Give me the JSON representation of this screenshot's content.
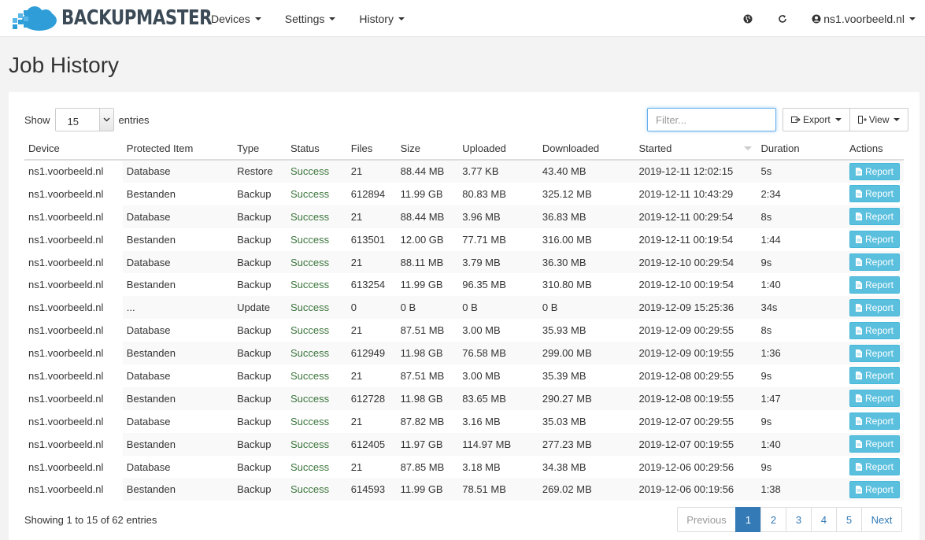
{
  "navbar": {
    "brand": "BACKUPMASTER",
    "menu": [
      {
        "label": "Devices"
      },
      {
        "label": "Settings"
      },
      {
        "label": "History"
      }
    ],
    "user": "ns1.voorbeeld.nl",
    "icons": [
      "globe-icon",
      "refresh-icon",
      "user-icon"
    ]
  },
  "page_title": "Job History",
  "controls": {
    "show_label": "Show",
    "entries_value": "15",
    "entries_label": "entries",
    "filter_placeholder": "Filter...",
    "export_label": "Export",
    "view_label": "View"
  },
  "table": {
    "columns": [
      "Device",
      "Protected Item",
      "Type",
      "Status",
      "Files",
      "Size",
      "Uploaded",
      "Downloaded",
      "Started",
      "Duration",
      "Actions"
    ],
    "action_label": "Report",
    "rows": [
      [
        "ns1.voorbeeld.nl",
        "Database",
        "Restore",
        "Success",
        "21",
        "88.44 MB",
        "3.77 KB",
        "43.40 MB",
        "2019-12-11 12:02:15",
        "5s"
      ],
      [
        "ns1.voorbeeld.nl",
        "Bestanden",
        "Backup",
        "Success",
        "612894",
        "11.99 GB",
        "80.83 MB",
        "325.12 MB",
        "2019-12-11 10:43:29",
        "2:34"
      ],
      [
        "ns1.voorbeeld.nl",
        "Database",
        "Backup",
        "Success",
        "21",
        "88.44 MB",
        "3.96 MB",
        "36.83 MB",
        "2019-12-11 00:29:54",
        "8s"
      ],
      [
        "ns1.voorbeeld.nl",
        "Bestanden",
        "Backup",
        "Success",
        "613501",
        "12.00 GB",
        "77.71 MB",
        "316.00 MB",
        "2019-12-11 00:19:54",
        "1:44"
      ],
      [
        "ns1.voorbeeld.nl",
        "Database",
        "Backup",
        "Success",
        "21",
        "88.11 MB",
        "3.79 MB",
        "36.30 MB",
        "2019-12-10 00:29:54",
        "9s"
      ],
      [
        "ns1.voorbeeld.nl",
        "Bestanden",
        "Backup",
        "Success",
        "613254",
        "11.99 GB",
        "96.35 MB",
        "310.80 MB",
        "2019-12-10 00:19:54",
        "1:40"
      ],
      [
        "ns1.voorbeeld.nl",
        "...",
        "Update",
        "Success",
        "0",
        "0 B",
        "0 B",
        "0 B",
        "2019-12-09 15:25:36",
        "34s"
      ],
      [
        "ns1.voorbeeld.nl",
        "Database",
        "Backup",
        "Success",
        "21",
        "87.51 MB",
        "3.00 MB",
        "35.93 MB",
        "2019-12-09 00:29:55",
        "8s"
      ],
      [
        "ns1.voorbeeld.nl",
        "Bestanden",
        "Backup",
        "Success",
        "612949",
        "11.98 GB",
        "76.58 MB",
        "299.00 MB",
        "2019-12-09 00:19:55",
        "1:36"
      ],
      [
        "ns1.voorbeeld.nl",
        "Database",
        "Backup",
        "Success",
        "21",
        "87.51 MB",
        "3.00 MB",
        "35.39 MB",
        "2019-12-08 00:29:55",
        "9s"
      ],
      [
        "ns1.voorbeeld.nl",
        "Bestanden",
        "Backup",
        "Success",
        "612728",
        "11.98 GB",
        "83.65 MB",
        "290.27 MB",
        "2019-12-08 00:19:55",
        "1:47"
      ],
      [
        "ns1.voorbeeld.nl",
        "Database",
        "Backup",
        "Success",
        "21",
        "87.82 MB",
        "3.16 MB",
        "35.03 MB",
        "2019-12-07 00:29:55",
        "9s"
      ],
      [
        "ns1.voorbeeld.nl",
        "Bestanden",
        "Backup",
        "Success",
        "612405",
        "11.97 GB",
        "114.97 MB",
        "277.23 MB",
        "2019-12-07 00:19:55",
        "1:40"
      ],
      [
        "ns1.voorbeeld.nl",
        "Database",
        "Backup",
        "Success",
        "21",
        "87.85 MB",
        "3.18 MB",
        "34.38 MB",
        "2019-12-06 00:29:56",
        "9s"
      ],
      [
        "ns1.voorbeeld.nl",
        "Bestanden",
        "Backup",
        "Success",
        "614593",
        "11.99 GB",
        "78.51 MB",
        "269.02 MB",
        "2019-12-06 00:19:56",
        "1:38"
      ]
    ]
  },
  "footer": {
    "showing_text": "Showing 1 to 15 of 62 entries",
    "pagination": {
      "previous": "Previous",
      "pages": [
        "1",
        "2",
        "3",
        "4",
        "5"
      ],
      "active": "1",
      "next": "Next"
    }
  },
  "colors": {
    "brand_text": "#3b4a56",
    "brand_cloud": "#2f9ed8",
    "success": "#3c763d",
    "report_button": "#5bc0de",
    "pagination_active": "#337ab7"
  }
}
